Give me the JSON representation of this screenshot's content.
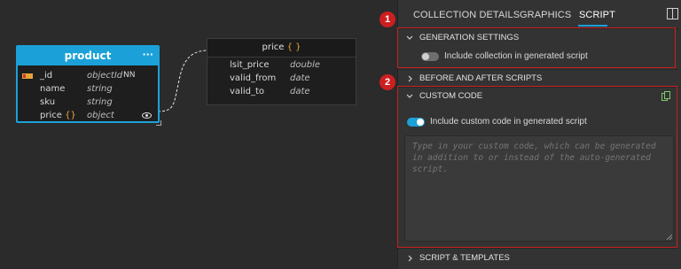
{
  "diagram": {
    "product": {
      "title": "product",
      "menu": "···",
      "fields": [
        {
          "name": "_id",
          "type": "objectId",
          "nn": "NN"
        },
        {
          "name": "name",
          "type": "string",
          "nn": ""
        },
        {
          "name": "sku",
          "type": "string",
          "nn": ""
        },
        {
          "name": "price",
          "brace": "{}",
          "type": "object",
          "nn": ""
        }
      ]
    },
    "price": {
      "title": "price",
      "brace": "{ }",
      "fields": [
        {
          "name": "lsit_price",
          "type": "double"
        },
        {
          "name": "valid_from",
          "type": "date"
        },
        {
          "name": "valid_to",
          "type": "date"
        }
      ]
    }
  },
  "panel": {
    "tabs": [
      {
        "label": "COLLECTION DETAILS",
        "active": false
      },
      {
        "label": "GRAPHICS",
        "active": false
      },
      {
        "label": "SCRIPT",
        "active": true
      }
    ],
    "sections": {
      "generation_settings": {
        "title": "GENERATION SETTINGS",
        "toggle_label": "Include collection in generated script",
        "toggle_on": false
      },
      "before_after": {
        "title": "BEFORE AND AFTER SCRIPTS"
      },
      "custom_code": {
        "title": "CUSTOM CODE",
        "toggle_label": "Include custom code in generated script",
        "toggle_on": true,
        "placeholder": "Type in your custom code, which can be generated in addition to or instead of the auto-generated script."
      },
      "script_templates": {
        "title": "SCRIPT & TEMPLATES"
      }
    }
  },
  "annotations": [
    "1",
    "2"
  ],
  "colors": {
    "accent": "#1ba1d8",
    "highlight": "#cc1f1f",
    "brace": "#e5a43a"
  }
}
